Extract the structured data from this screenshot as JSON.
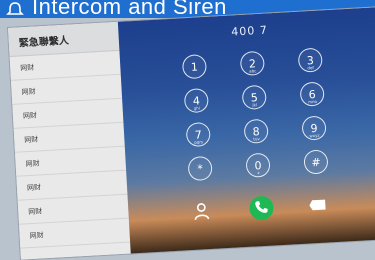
{
  "header": {
    "title": "Intercom and Siren",
    "accent_color": "#1f6fd1",
    "icon": "bell-icon"
  },
  "contacts": {
    "title": "緊急聯繫人",
    "items": [
      "网财",
      "网财",
      "网财",
      "网财",
      "网财",
      "网财",
      "网财",
      "网财"
    ]
  },
  "dialer": {
    "number": "400 7",
    "keys": [
      {
        "digit": "1",
        "sub": ""
      },
      {
        "digit": "2",
        "sub": "abc"
      },
      {
        "digit": "3",
        "sub": "def"
      },
      {
        "digit": "4",
        "sub": "ghi"
      },
      {
        "digit": "5",
        "sub": "jkl"
      },
      {
        "digit": "6",
        "sub": "mno"
      },
      {
        "digit": "7",
        "sub": "pqrs"
      },
      {
        "digit": "8",
        "sub": "tuv"
      },
      {
        "digit": "9",
        "sub": "wxyz"
      },
      {
        "digit": "*",
        "sub": ""
      },
      {
        "digit": "0",
        "sub": "+"
      },
      {
        "digit": "#",
        "sub": ""
      }
    ],
    "bottom_icons": [
      "person-icon",
      "phone-icon",
      "tag-icon"
    ],
    "call_color": "#1eb954"
  }
}
